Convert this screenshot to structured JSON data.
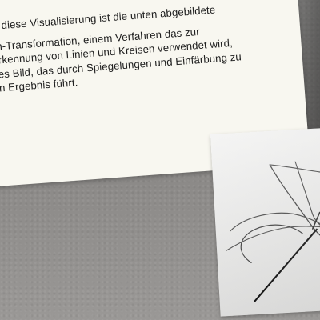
{
  "document": {
    "lines": [
      "ür diese Visualisierung ist die unten abgebildete",
      "",
      "gh-Transformation, einem Verfahren das zur",
      "Erkennung von Linien und Kreisen verwendet wird,",
      "ues Bild, das durch Spiegelungen und Einfärbung zu",
      "en Ergebnis führt."
    ]
  },
  "photo": {
    "subject": "hough-transformation-sketch",
    "line_color": "#3a3a3a",
    "accent_color": "#111111"
  },
  "colors": {
    "table": "#8b8987",
    "paper": "#f8f7f0",
    "photo": "#ececea"
  }
}
